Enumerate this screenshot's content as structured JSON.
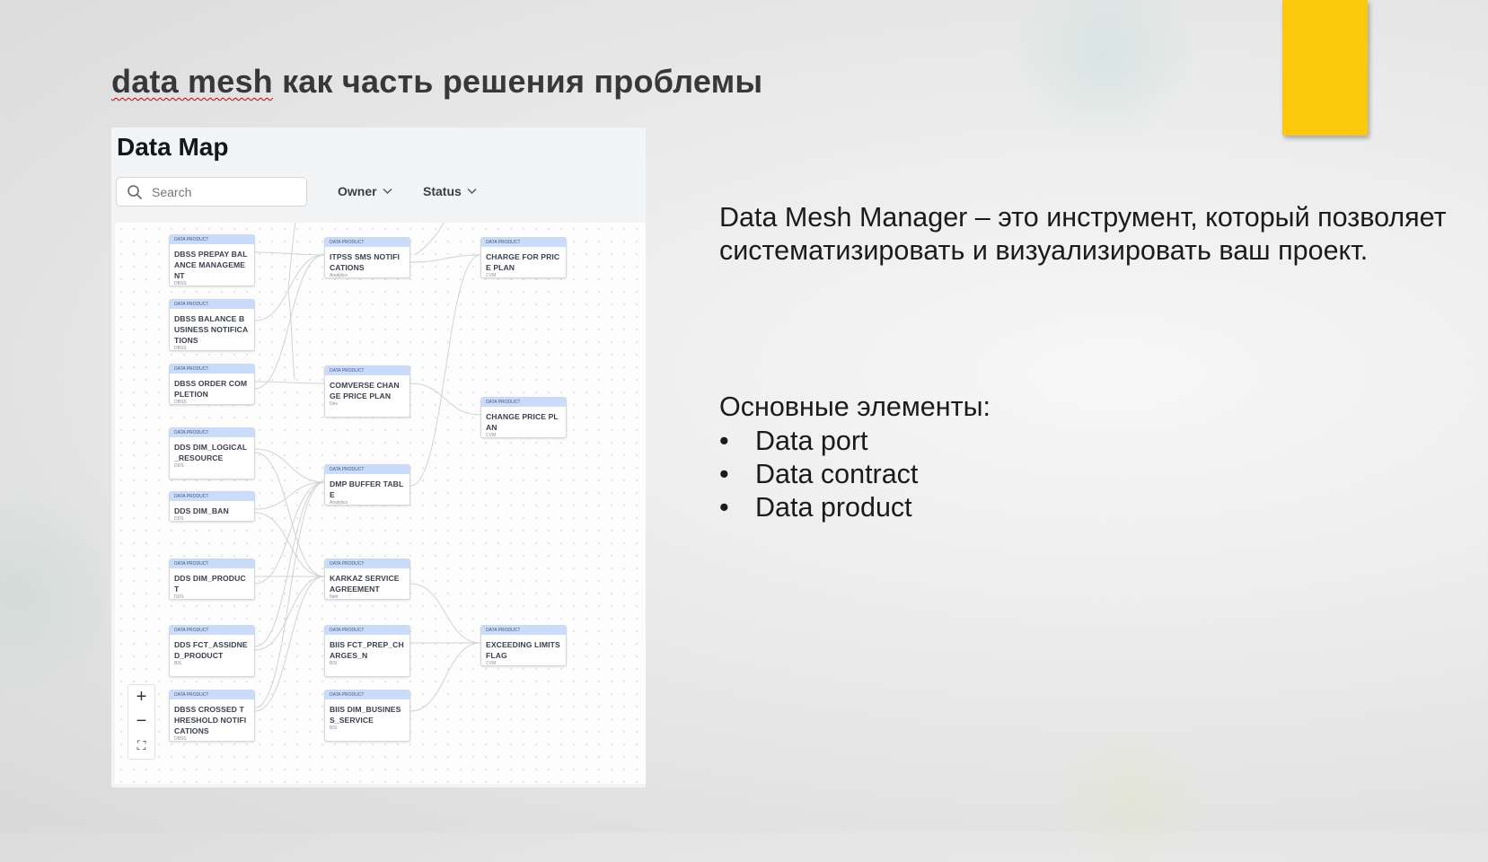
{
  "slide": {
    "title_prefix": "data mesh",
    "title_rest": " как часть решения проблемы",
    "description": "Data Mesh Manager – это инструмент, который позволяет систематизировать и визуализировать ваш проект.",
    "elements_title": "Основные элементы:",
    "elements": [
      "Data port",
      "Data contract",
      "Data product"
    ],
    "accent_color": "#fcc80c"
  },
  "data_map": {
    "title": "Data Map",
    "search_placeholder": "Search",
    "filters": [
      "Owner",
      "Status"
    ],
    "node_header": "DATA PRODUCT",
    "nodes": [
      {
        "id": "n1",
        "name": "DBSS PREPAY BALANCE MANAGEMENT",
        "owner": "DBSS"
      },
      {
        "id": "n2",
        "name": "DBSS BALANCE BUSINESS NOTIFICATIONS",
        "owner": "DBSS"
      },
      {
        "id": "n3",
        "name": "DBSS ORDER COMPLETION",
        "owner": "DBSS"
      },
      {
        "id": "n4",
        "name": "DDS DIM_LOGICAL_RESOURCE",
        "owner": "DDS"
      },
      {
        "id": "n5",
        "name": "DDS DIM_BAN",
        "owner": "DDS"
      },
      {
        "id": "n6",
        "name": "DDS DIM_PRODUCT",
        "owner": "DDS"
      },
      {
        "id": "n7",
        "name": "DDS FCT_ASSIDNED_PRODUCT",
        "owner": "BIS"
      },
      {
        "id": "n8",
        "name": "DBSS CROSSED THRESHOLD NOTIFICATIONS",
        "owner": "DBSS"
      },
      {
        "id": "m1",
        "name": "ITPSS SMS NOTIFICATIONS",
        "owner": "Analytics"
      },
      {
        "id": "m2",
        "name": "COMVERSE CHANGE PRICE PLAN",
        "owner": "Dev"
      },
      {
        "id": "m3",
        "name": "DMP BUFFER TABLE",
        "owner": "Analytics"
      },
      {
        "id": "m4",
        "name": "KARKAZ SERVICE AGREEMENT",
        "owner": "Nett"
      },
      {
        "id": "m5",
        "name": "BIIS FCT_PREP_CHARGES_N",
        "owner": "BIS"
      },
      {
        "id": "m6",
        "name": "BIIS DIM_BUSINESS_SERVICE",
        "owner": "BIS"
      },
      {
        "id": "r1",
        "name": "CHARGE FOR PRICE PLAN",
        "owner": "CVM"
      },
      {
        "id": "r2",
        "name": "CHANGE PRICE PLAN",
        "owner": "CVM"
      },
      {
        "id": "r3",
        "name": "EXCEEDING LIMITS FLAG",
        "owner": "CVM"
      }
    ],
    "edges": [
      [
        "n1",
        "m1"
      ],
      [
        "n2",
        "m1"
      ],
      [
        "n3",
        "m1"
      ],
      [
        "n3",
        "m2"
      ],
      [
        "n4",
        "m3"
      ],
      [
        "n4",
        "m4"
      ],
      [
        "n5",
        "m3"
      ],
      [
        "n5",
        "m4"
      ],
      [
        "n6",
        "m3"
      ],
      [
        "n6",
        "m4"
      ],
      [
        "n7",
        "m3"
      ],
      [
        "n7",
        "m4"
      ],
      [
        "n8",
        "m3"
      ],
      [
        "n8",
        "m4"
      ],
      [
        "m1",
        "r1"
      ],
      [
        "m2",
        "r2"
      ],
      [
        "m3",
        "r1"
      ],
      [
        "m4",
        "r3"
      ],
      [
        "m5",
        "r3"
      ],
      [
        "m6",
        "r3"
      ]
    ],
    "zoom_controls": [
      "+",
      "−",
      "⛶"
    ]
  }
}
